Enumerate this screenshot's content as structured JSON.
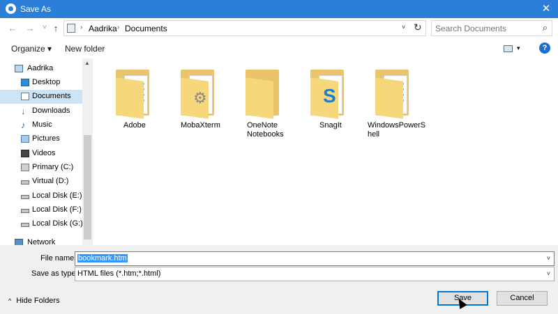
{
  "window": {
    "title": "Save As",
    "close_symbol": "✕",
    "icon": "app-icon"
  },
  "navigation": {
    "back": "←",
    "forward": "→",
    "recent": "˅",
    "up": "↑",
    "breadcrumb": [
      "Aadrika",
      "Documents"
    ],
    "breadcrumb_sep": "›",
    "address_dropdown": "˅",
    "refresh": "↻",
    "search_placeholder": "Search Documents",
    "search_icon": "⌕"
  },
  "toolbar": {
    "organize": "Organize ▾",
    "new_folder": "New folder",
    "view_dropdown": "▾",
    "help": "?"
  },
  "nav_pane": {
    "items": [
      {
        "label": "Aadrika",
        "icon": "computer-icon"
      },
      {
        "label": "Desktop",
        "icon": "desktop-icon"
      },
      {
        "label": "Documents",
        "icon": "documents-icon",
        "selected": true
      },
      {
        "label": "Downloads",
        "icon": "downloads-icon"
      },
      {
        "label": "Music",
        "icon": "music-icon"
      },
      {
        "label": "Pictures",
        "icon": "pictures-icon"
      },
      {
        "label": "Videos",
        "icon": "videos-icon"
      },
      {
        "label": "Primary (C:)",
        "icon": "system-drive-icon"
      },
      {
        "label": "Virtual (D:)",
        "icon": "drive-icon"
      },
      {
        "label": "Local Disk (E:)",
        "icon": "drive-icon"
      },
      {
        "label": "Local Disk (F:)",
        "icon": "drive-icon"
      },
      {
        "label": "Local Disk (G:)",
        "icon": "drive-icon"
      },
      {
        "label": "Network",
        "icon": "network-icon"
      }
    ]
  },
  "files": [
    {
      "label": "Adobe",
      "icon": "folder-icon"
    },
    {
      "label": "MobaXterm",
      "icon": "folder-icon"
    },
    {
      "label": "OneNote\nNotebooks",
      "icon": "folder-icon"
    },
    {
      "label": "SnagIt",
      "icon": "folder-icon"
    },
    {
      "label": "WindowsPowerS\nhell",
      "icon": "folder-icon"
    }
  ],
  "form": {
    "file_name_label": "File name:",
    "file_name_value": "bookmark.htm",
    "save_as_type_label": "Save as type:",
    "save_as_type_value": "HTML files (*.htm;*.html)",
    "dropdown_symbol": "˅",
    "hide_folders": "Hide Folders",
    "hide_folders_chevron": "^",
    "save_button": "Save",
    "cancel_button": "Cancel"
  },
  "colors": {
    "titlebar": "#2b7fd8",
    "selection": "#cce4f7",
    "folder": "#f6d77c",
    "accent": "#0078d7"
  }
}
